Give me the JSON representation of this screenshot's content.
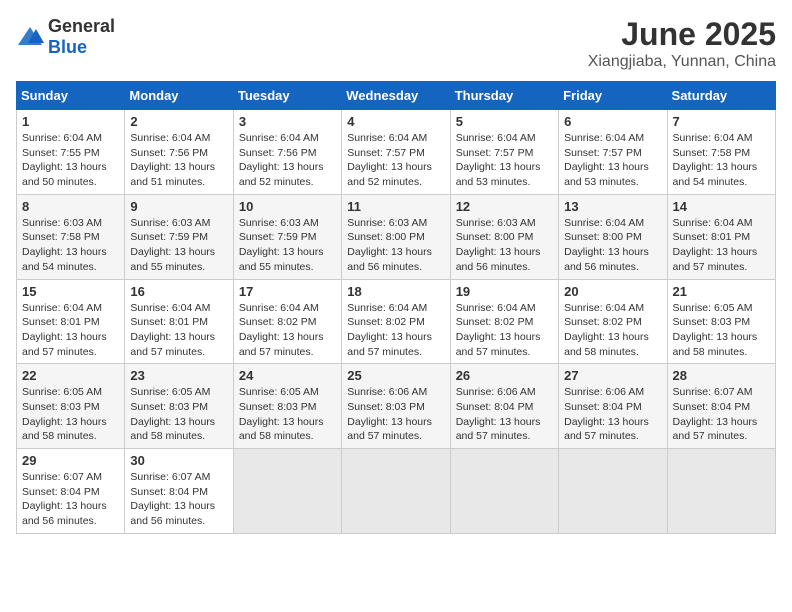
{
  "header": {
    "logo_general": "General",
    "logo_blue": "Blue",
    "month": "June 2025",
    "location": "Xiangjiaba, Yunnan, China"
  },
  "weekdays": [
    "Sunday",
    "Monday",
    "Tuesday",
    "Wednesday",
    "Thursday",
    "Friday",
    "Saturday"
  ],
  "weeks": [
    [
      {
        "day": "1",
        "sunrise": "6:04 AM",
        "sunset": "7:55 PM",
        "daylight": "13 hours and 50 minutes."
      },
      {
        "day": "2",
        "sunrise": "6:04 AM",
        "sunset": "7:56 PM",
        "daylight": "13 hours and 51 minutes."
      },
      {
        "day": "3",
        "sunrise": "6:04 AM",
        "sunset": "7:56 PM",
        "daylight": "13 hours and 52 minutes."
      },
      {
        "day": "4",
        "sunrise": "6:04 AM",
        "sunset": "7:57 PM",
        "daylight": "13 hours and 52 minutes."
      },
      {
        "day": "5",
        "sunrise": "6:04 AM",
        "sunset": "7:57 PM",
        "daylight": "13 hours and 53 minutes."
      },
      {
        "day": "6",
        "sunrise": "6:04 AM",
        "sunset": "7:57 PM",
        "daylight": "13 hours and 53 minutes."
      },
      {
        "day": "7",
        "sunrise": "6:04 AM",
        "sunset": "7:58 PM",
        "daylight": "13 hours and 54 minutes."
      }
    ],
    [
      {
        "day": "8",
        "sunrise": "6:03 AM",
        "sunset": "7:58 PM",
        "daylight": "13 hours and 54 minutes."
      },
      {
        "day": "9",
        "sunrise": "6:03 AM",
        "sunset": "7:59 PM",
        "daylight": "13 hours and 55 minutes."
      },
      {
        "day": "10",
        "sunrise": "6:03 AM",
        "sunset": "7:59 PM",
        "daylight": "13 hours and 55 minutes."
      },
      {
        "day": "11",
        "sunrise": "6:03 AM",
        "sunset": "8:00 PM",
        "daylight": "13 hours and 56 minutes."
      },
      {
        "day": "12",
        "sunrise": "6:03 AM",
        "sunset": "8:00 PM",
        "daylight": "13 hours and 56 minutes."
      },
      {
        "day": "13",
        "sunrise": "6:04 AM",
        "sunset": "8:00 PM",
        "daylight": "13 hours and 56 minutes."
      },
      {
        "day": "14",
        "sunrise": "6:04 AM",
        "sunset": "8:01 PM",
        "daylight": "13 hours and 57 minutes."
      }
    ],
    [
      {
        "day": "15",
        "sunrise": "6:04 AM",
        "sunset": "8:01 PM",
        "daylight": "13 hours and 57 minutes."
      },
      {
        "day": "16",
        "sunrise": "6:04 AM",
        "sunset": "8:01 PM",
        "daylight": "13 hours and 57 minutes."
      },
      {
        "day": "17",
        "sunrise": "6:04 AM",
        "sunset": "8:02 PM",
        "daylight": "13 hours and 57 minutes."
      },
      {
        "day": "18",
        "sunrise": "6:04 AM",
        "sunset": "8:02 PM",
        "daylight": "13 hours and 57 minutes."
      },
      {
        "day": "19",
        "sunrise": "6:04 AM",
        "sunset": "8:02 PM",
        "daylight": "13 hours and 57 minutes."
      },
      {
        "day": "20",
        "sunrise": "6:04 AM",
        "sunset": "8:02 PM",
        "daylight": "13 hours and 58 minutes."
      },
      {
        "day": "21",
        "sunrise": "6:05 AM",
        "sunset": "8:03 PM",
        "daylight": "13 hours and 58 minutes."
      }
    ],
    [
      {
        "day": "22",
        "sunrise": "6:05 AM",
        "sunset": "8:03 PM",
        "daylight": "13 hours and 58 minutes."
      },
      {
        "day": "23",
        "sunrise": "6:05 AM",
        "sunset": "8:03 PM",
        "daylight": "13 hours and 58 minutes."
      },
      {
        "day": "24",
        "sunrise": "6:05 AM",
        "sunset": "8:03 PM",
        "daylight": "13 hours and 58 minutes."
      },
      {
        "day": "25",
        "sunrise": "6:06 AM",
        "sunset": "8:03 PM",
        "daylight": "13 hours and 57 minutes."
      },
      {
        "day": "26",
        "sunrise": "6:06 AM",
        "sunset": "8:04 PM",
        "daylight": "13 hours and 57 minutes."
      },
      {
        "day": "27",
        "sunrise": "6:06 AM",
        "sunset": "8:04 PM",
        "daylight": "13 hours and 57 minutes."
      },
      {
        "day": "28",
        "sunrise": "6:07 AM",
        "sunset": "8:04 PM",
        "daylight": "13 hours and 57 minutes."
      }
    ],
    [
      {
        "day": "29",
        "sunrise": "6:07 AM",
        "sunset": "8:04 PM",
        "daylight": "13 hours and 56 minutes."
      },
      {
        "day": "30",
        "sunrise": "6:07 AM",
        "sunset": "8:04 PM",
        "daylight": "13 hours and 56 minutes."
      },
      null,
      null,
      null,
      null,
      null
    ]
  ],
  "labels": {
    "sunrise": "Sunrise:",
    "sunset": "Sunset:",
    "daylight": "Daylight:"
  }
}
